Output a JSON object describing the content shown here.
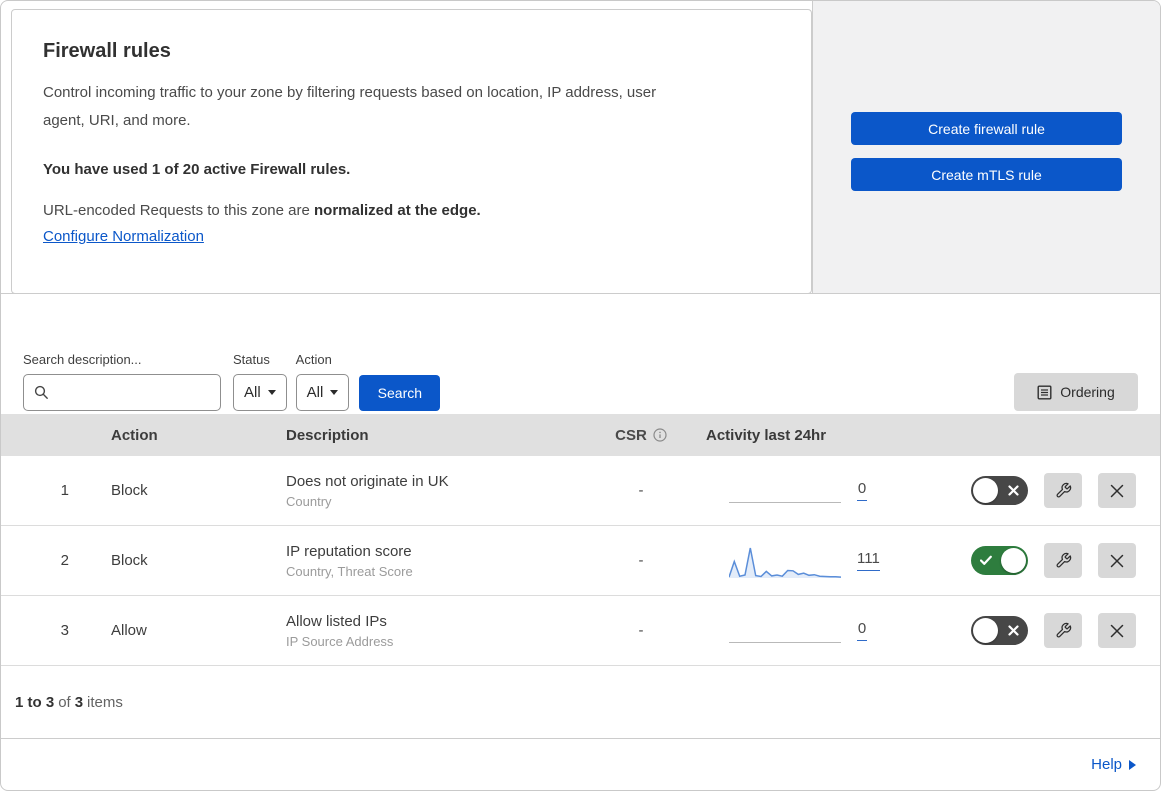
{
  "header": {
    "title": "Firewall rules",
    "description": "Control incoming traffic to your zone by filtering requests based on location, IP address, user agent, URI, and more.",
    "usage": "You have used 1 of 20 active Firewall rules.",
    "normalization_prefix": "URL-encoded Requests to this zone are ",
    "normalization_bold": "normalized at the edge.",
    "normalization_link": "Configure Normalization",
    "create_firewall_label": "Create firewall rule",
    "create_mtls_label": "Create mTLS rule"
  },
  "filters": {
    "search_label": "Search description...",
    "search_value": "",
    "status_label": "Status",
    "status_value": "All",
    "action_label": "Action",
    "action_value": "All",
    "search_button": "Search",
    "ordering_button": "Ordering"
  },
  "table": {
    "header": {
      "action": "Action",
      "description": "Description",
      "csr": "CSR",
      "activity": "Activity last 24hr"
    },
    "rows": [
      {
        "priority": "1",
        "action": "Block",
        "description": "Does not originate in UK",
        "criteria": "Country",
        "csr": "-",
        "activity_count": "0",
        "enabled": false,
        "sparkline": []
      },
      {
        "priority": "2",
        "action": "Block",
        "description": "IP reputation score",
        "criteria": "Country, Threat Score",
        "csr": "-",
        "activity_count": "111",
        "enabled": true,
        "sparkline": [
          3,
          55,
          6,
          10,
          100,
          8,
          5,
          22,
          7,
          10,
          6,
          25,
          24,
          12,
          16,
          9,
          11,
          6,
          5,
          4,
          4,
          3
        ]
      },
      {
        "priority": "3",
        "action": "Allow",
        "description": "Allow listed IPs",
        "criteria": "IP Source Address",
        "csr": "-",
        "activity_count": "0",
        "enabled": false,
        "sparkline": []
      }
    ]
  },
  "footer": {
    "range": "1 to 3",
    "of": "of",
    "total": "3",
    "items": "items",
    "help": "Help"
  },
  "colors": {
    "accent": "#0b57c9",
    "toggle_on": "#2e7d3e",
    "toggle_off": "#474747",
    "sparkline_line": "#5b8ed9",
    "sparkline_fill": "rgba(101,148,220,0.18)"
  }
}
